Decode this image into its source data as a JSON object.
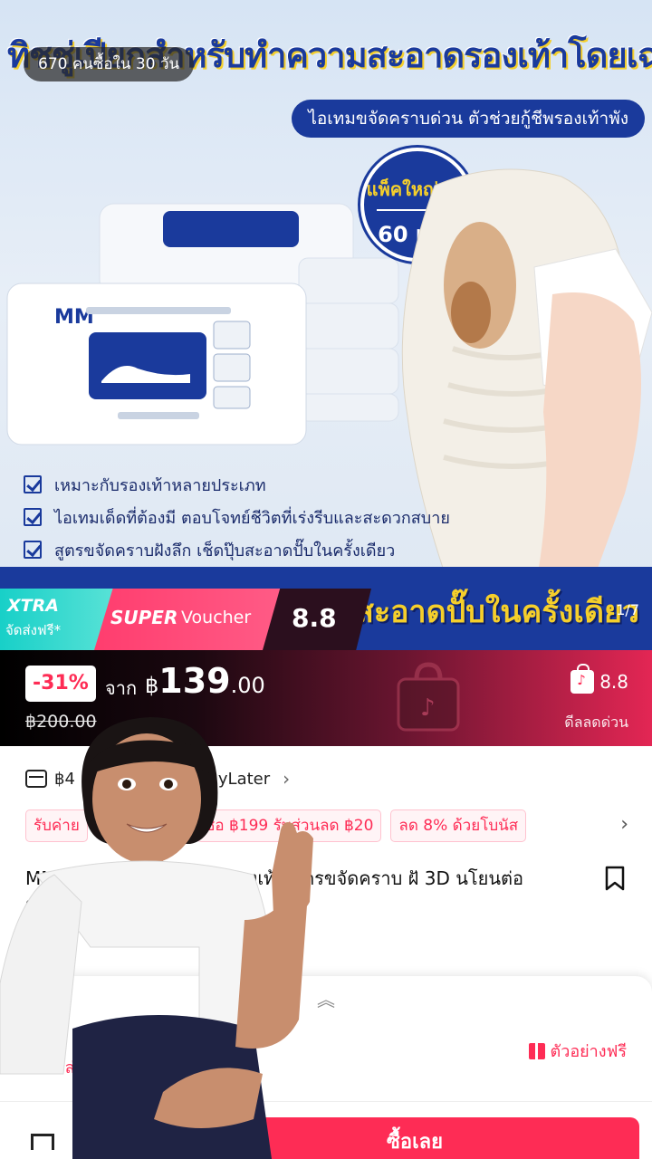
{
  "hero": {
    "title": "ทิชชู่เปียกสำหรับทำความสะอาดรองเท้าโดยเฉพาะ",
    "subtitle": "ไอเทมขจัดคราบด่วน ตัวช่วยกู้ชีพรองเท้าพัง",
    "badge_line1": "แพ็คใหญ่จุใจ",
    "badge_line2": "60 แผ่น",
    "features": [
      "เหมาะกับรองเท้าหลายประเภท",
      "ไอเทมเด็ดที่ต้องมี ตอบโจทย์ชีวิตที่เร่งรีบและสะดวกสบาย",
      "สูตรขจัดคราบฝังลึก เช็ดปุ๊บสะอาดปั๊บในครั้งเดียว"
    ],
    "band_text": "สะอาดปั๊บในครั้งเดียว",
    "image_counter": "1/7",
    "sold_badge": "670 คนซื้อใน 30 วัน"
  },
  "promo": {
    "xtra_title": "XTRA",
    "xtra_sub": "จัดส่งฟรี*",
    "super_title": "SUPER",
    "super_voucher": "Voucher",
    "campaign": "8.8"
  },
  "price": {
    "discount": "-31%",
    "from_label": "จาก",
    "currency": "฿",
    "integer": "139",
    "decimal": ".00",
    "original": "฿200.00",
    "campaign": "8.8",
    "flash_label": "ดีลลดด่วน"
  },
  "info": {
    "paylater_text": "฿4",
    "paylater_suffix": "yLater",
    "coupons": [
      "รับค่าย",
      "ซื้อ ฿199 รับส่วนลด ฿20",
      "ลด 8% ด้วยโบนัส"
    ],
    "product_title": "MM ทิ สำหรับทำค สะอาดรองเท้า สูตรขจัดคราบ ฝั 3D นโยนต่อรองเท้า พกพาสะด..."
  },
  "sheet": {
    "source_label": "แหล่ง",
    "free_sample": "ตัวอย่างฟรี",
    "buy_now": "ซื้อเลย"
  },
  "colors": {
    "tiktok_red": "#fe2c55",
    "brand_blue": "#1a3a9c",
    "accent_yellow": "#f5cf2b"
  }
}
